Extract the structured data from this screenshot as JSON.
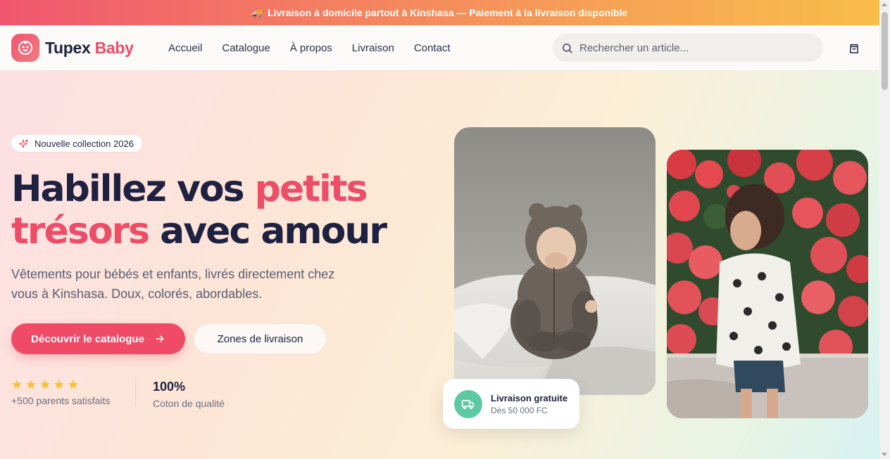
{
  "promo": {
    "icon": "delivery-truck-emoji",
    "text": "Livraison à domicile partout à Kinshasa — Paiement à la livraison disponible"
  },
  "header": {
    "logo": {
      "icon": "baby-face-icon",
      "name_part1": "Tupex",
      "name_part2": "Baby"
    },
    "nav": [
      {
        "label": "Accueil"
      },
      {
        "label": "Catalogue"
      },
      {
        "label": "À propos"
      },
      {
        "label": "Livraison"
      },
      {
        "label": "Contact"
      }
    ],
    "search": {
      "placeholder": "Rechercher un article...",
      "value": ""
    },
    "cart_icon": "shopping-bag-icon"
  },
  "hero": {
    "badge": {
      "icon": "sparkle-icon",
      "label": "Nouvelle collection 2026"
    },
    "headline": {
      "part1": "Habillez vos ",
      "part2": "petits trésors",
      "part3": " avec amour"
    },
    "subtitle": "Vêtements pour bébés et enfants, livrés directement chez vous à Kinshasa. Doux, colorés, abordables.",
    "primary_button": {
      "label": "Découvrir le catalogue",
      "icon": "arrow-right-icon"
    },
    "secondary_button": {
      "label": "Zones de livraison"
    },
    "rating": {
      "stars": 5,
      "caption": "+500 parents satisfaits"
    },
    "stat": {
      "value": "100%",
      "caption": "Coton de qualité"
    },
    "delivery_card": {
      "icon": "truck-icon",
      "title": "Livraison gratuite",
      "subtitle": "Dès 50 000 FC"
    }
  },
  "colors": {
    "accent": "#ee4d68",
    "dark": "#1e2140",
    "success": "#5cc9a2",
    "star": "#f6c23e"
  }
}
